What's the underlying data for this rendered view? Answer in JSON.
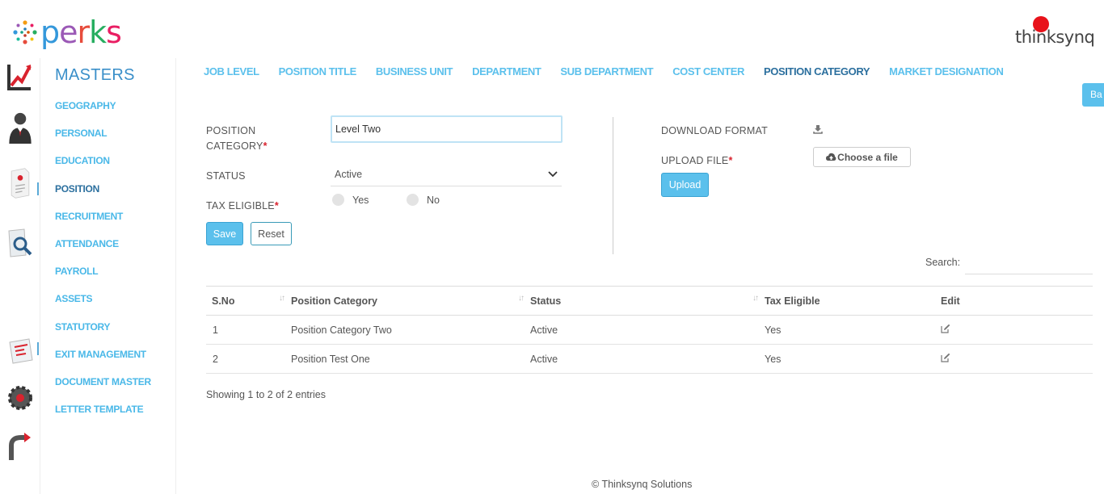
{
  "app": {
    "name": "perks",
    "company": "thinksynq"
  },
  "sidebar": {
    "title": "MASTERS",
    "items": [
      {
        "label": "GEOGRAPHY",
        "active": false
      },
      {
        "label": "PERSONAL",
        "active": false
      },
      {
        "label": "EDUCATION",
        "active": false
      },
      {
        "label": "POSITION",
        "active": true
      },
      {
        "label": "RECRUITMENT",
        "active": false
      },
      {
        "label": "ATTENDANCE",
        "active": false
      },
      {
        "label": "PAYROLL",
        "active": false
      },
      {
        "label": "ASSETS",
        "active": false
      },
      {
        "label": "STATUTORY",
        "active": false
      },
      {
        "label": "EXIT MANAGEMENT",
        "active": false
      },
      {
        "label": "DOCUMENT MASTER",
        "active": false
      },
      {
        "label": "LETTER TEMPLATE",
        "active": false
      }
    ]
  },
  "rail": [
    "chart-icon",
    "user-icon",
    "document-icon",
    "search-icon",
    "forms-icon",
    "settings-gear-icon",
    "exit-icon"
  ],
  "tabs": [
    {
      "label": "JOB LEVEL",
      "active": false
    },
    {
      "label": "POSITION TITLE",
      "active": false
    },
    {
      "label": "BUSINESS UNIT",
      "active": false
    },
    {
      "label": "DEPARTMENT",
      "active": false
    },
    {
      "label": "SUB DEPARTMENT",
      "active": false
    },
    {
      "label": "COST CENTER",
      "active": false
    },
    {
      "label": "POSITION CATEGORY",
      "active": true
    },
    {
      "label": "MARKET DESIGNATION",
      "active": false
    }
  ],
  "back_label": "Ba",
  "form": {
    "category_label_1": "POSITION",
    "category_label_2": "CATEGORY",
    "category_value": "Level Two",
    "status_label": "STATUS",
    "status_value": "Active",
    "tax_label": "TAX ELIGIBLE",
    "yes_label": "Yes",
    "no_label": "No",
    "save_label": "Save",
    "reset_label": "Reset",
    "required_mark": "*"
  },
  "upload": {
    "download_label": "DOWNLOAD FORMAT",
    "upload_label": "UPLOAD FILE",
    "choose_label": "Choose a file",
    "upload_button": "Upload"
  },
  "table": {
    "search_label": "Search:",
    "columns": [
      "S.No",
      "Position Category",
      "Status",
      "Tax Eligible",
      "Edit"
    ],
    "rows": [
      {
        "sno": "1",
        "category": "Position Category Two",
        "status": "Active",
        "tax": "Yes"
      },
      {
        "sno": "2",
        "category": "Position Test One",
        "status": "Active",
        "tax": "Yes"
      }
    ],
    "info": "Showing 1 to 2 of 2 entries"
  },
  "footer": "© Thinksynq Solutions",
  "colors": {
    "accent": "#5bc0ec",
    "active_nav": "#2b6f9e",
    "required": "#d9232e"
  }
}
